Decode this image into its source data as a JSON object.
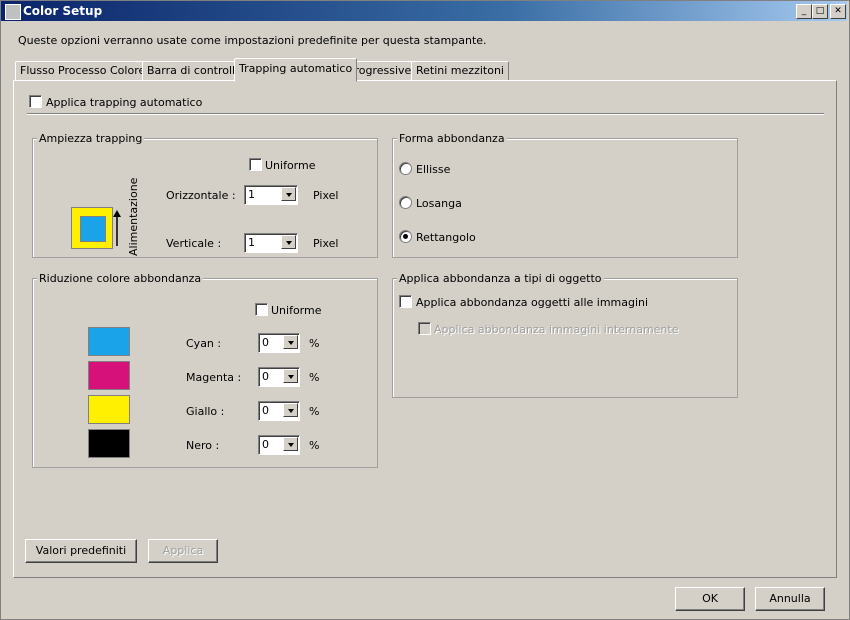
{
  "window": {
    "title": "Color Setup",
    "minimize": "_",
    "maximize": "□",
    "close": "✕"
  },
  "description": "Queste opzioni verranno usate come impostazioni predefinite per questa stampante.",
  "tabs": [
    {
      "label": "Flusso Processo Colore"
    },
    {
      "label": "Barra di controllo"
    },
    {
      "label": "Trapping automatico"
    },
    {
      "label": "Progressive"
    },
    {
      "label": "Retini mezzitoni"
    }
  ],
  "auto_trap": {
    "label": "Applica trapping automatico",
    "checked": false
  },
  "trap_width": {
    "title": "Ampiezza trapping",
    "uniform_label": "Uniforme",
    "feed_label": "Alimentazione",
    "horizontal_label": "Orizzontale :",
    "horizontal_value": "1",
    "vertical_label": "Verticale :",
    "vertical_value": "1",
    "unit": "Pixel"
  },
  "trap_shape": {
    "title": "Forma abbondanza",
    "options": [
      {
        "label": "Ellisse",
        "selected": false
      },
      {
        "label": "Losanga",
        "selected": false
      },
      {
        "label": "Rettangolo",
        "selected": true
      }
    ]
  },
  "color_reduction": {
    "title": "Riduzione colore abbondanza",
    "uniform_label": "Uniforme",
    "unit": "%",
    "rows": [
      {
        "label": "Cyan :",
        "value": "0",
        "color": "#1aa3e8"
      },
      {
        "label": "Magenta :",
        "value": "0",
        "color": "#d6127a"
      },
      {
        "label": "Giallo :",
        "value": "0",
        "color": "#ffef00"
      },
      {
        "label": "Nero :",
        "value": "0",
        "color": "#000000"
      }
    ]
  },
  "object_types": {
    "title": "Applica abbondanza a tipi di oggetto",
    "images_label": "Applica abbondanza oggetti alle immagini",
    "internal_label": "Applica abbondanza immagini internamente"
  },
  "buttons": {
    "defaults": "Valori predefiniti",
    "apply": "Applica",
    "ok": "OK",
    "cancel": "Annulla"
  },
  "colors": {
    "titlebar": "#0a246a",
    "background": "#d4d0c8",
    "trap_preview_outer": "#ffef00",
    "trap_preview_inner": "#1aa3e8"
  }
}
